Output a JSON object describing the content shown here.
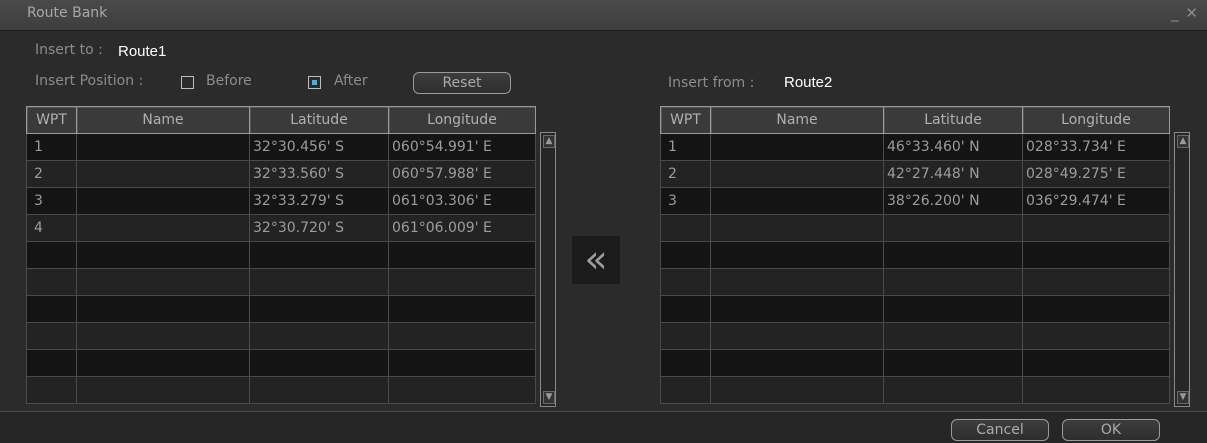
{
  "window": {
    "title": "Route Bank",
    "controls": "_ ✕"
  },
  "insert_to": {
    "label": "Insert to :",
    "value": "Route1"
  },
  "insert_position": {
    "label": "Insert Position :",
    "options": [
      {
        "label": "Before",
        "checked": false
      },
      {
        "label": "After",
        "checked": true
      }
    ],
    "reset_label": "Reset"
  },
  "insert_from": {
    "label": "Insert from :",
    "value": "Route2"
  },
  "columns": [
    "WPT",
    "Name",
    "Latitude",
    "Longitude"
  ],
  "left_table": {
    "rows": [
      {
        "wpt": "1",
        "name": "",
        "lat": "32°30.456' S",
        "lon": "060°54.991' E"
      },
      {
        "wpt": "2",
        "name": "",
        "lat": "32°33.560' S",
        "lon": "060°57.988' E"
      },
      {
        "wpt": "3",
        "name": "",
        "lat": "32°33.279' S",
        "lon": "061°03.306' E"
      },
      {
        "wpt": "4",
        "name": "",
        "lat": "32°30.720' S",
        "lon": "061°06.009' E"
      },
      {
        "wpt": "",
        "name": "",
        "lat": "",
        "lon": ""
      },
      {
        "wpt": "",
        "name": "",
        "lat": "",
        "lon": ""
      },
      {
        "wpt": "",
        "name": "",
        "lat": "",
        "lon": ""
      },
      {
        "wpt": "",
        "name": "",
        "lat": "",
        "lon": ""
      },
      {
        "wpt": "",
        "name": "",
        "lat": "",
        "lon": ""
      },
      {
        "wpt": "",
        "name": "",
        "lat": "",
        "lon": ""
      }
    ]
  },
  "right_table": {
    "rows": [
      {
        "wpt": "1",
        "name": "",
        "lat": "46°33.460' N",
        "lon": "028°33.734' E"
      },
      {
        "wpt": "2",
        "name": "",
        "lat": "42°27.448' N",
        "lon": "028°49.275' E"
      },
      {
        "wpt": "3",
        "name": "",
        "lat": "38°26.200' N",
        "lon": "036°29.474' E"
      },
      {
        "wpt": "",
        "name": "",
        "lat": "",
        "lon": ""
      },
      {
        "wpt": "",
        "name": "",
        "lat": "",
        "lon": ""
      },
      {
        "wpt": "",
        "name": "",
        "lat": "",
        "lon": ""
      },
      {
        "wpt": "",
        "name": "",
        "lat": "",
        "lon": ""
      },
      {
        "wpt": "",
        "name": "",
        "lat": "",
        "lon": ""
      },
      {
        "wpt": "",
        "name": "",
        "lat": "",
        "lon": ""
      },
      {
        "wpt": "",
        "name": "",
        "lat": "",
        "lon": ""
      }
    ]
  },
  "transfer_icon": "double-chevron-left",
  "transfer_glyph": "«",
  "footer": {
    "cancel_label": "Cancel",
    "ok_label": "OK"
  },
  "colors": {
    "selected_checkbox": "#3fb3e0",
    "value_text": "#ffffff"
  }
}
